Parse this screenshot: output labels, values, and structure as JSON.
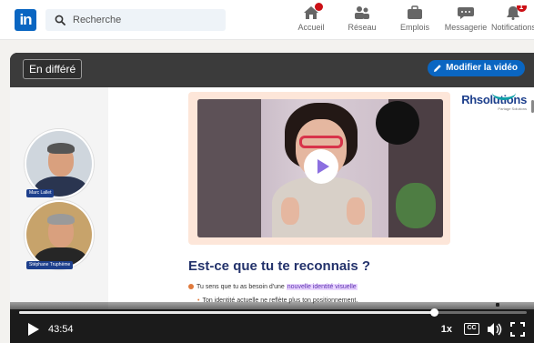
{
  "app": {
    "logo_text": "in",
    "brand_color": "#0a66c2"
  },
  "search": {
    "placeholder": "Recherche",
    "icon": "search-icon"
  },
  "nav": {
    "items": [
      {
        "label": "Accueil",
        "icon": "home-icon",
        "badge": "",
        "badge_dot": true
      },
      {
        "label": "Réseau",
        "icon": "network-icon",
        "badge": ""
      },
      {
        "label": "Emplois",
        "icon": "briefcase-icon",
        "badge": ""
      },
      {
        "label": "Messagerie",
        "icon": "messaging-icon",
        "badge": ""
      },
      {
        "label": "Notifications",
        "icon": "bell-icon",
        "badge": "1"
      }
    ]
  },
  "player": {
    "status_label": "En différé",
    "edit_button_label": "Modifier la vidéo",
    "current_time": "43:54",
    "progress_fraction": 0.818,
    "speed_label": "1x",
    "captions_label": "CC"
  },
  "speakers": [
    {
      "name": "Marc Lallet",
      "shirt_color": "#2a3550",
      "hair_color": "#555555",
      "bg_color": "#cfd6dd"
    },
    {
      "name": "Stéphane Truphème",
      "shirt_color": "#262626",
      "hair_color": "#9a9a9a",
      "bg_color": "#c7a36b"
    }
  ],
  "slide": {
    "brand_name_part1": "Rh",
    "brand_name_part2": "solutions",
    "brand_tagline": "Partage Solutions",
    "title": "Est-ce que tu te reconnais ?",
    "bullet1_prefix": "Tu sens que tu as besoin d'une ",
    "bullet1_highlight": "nouvelle identité visuelle",
    "bullet2": "Ton identité actuelle ne reflète plus ton positionnement."
  }
}
